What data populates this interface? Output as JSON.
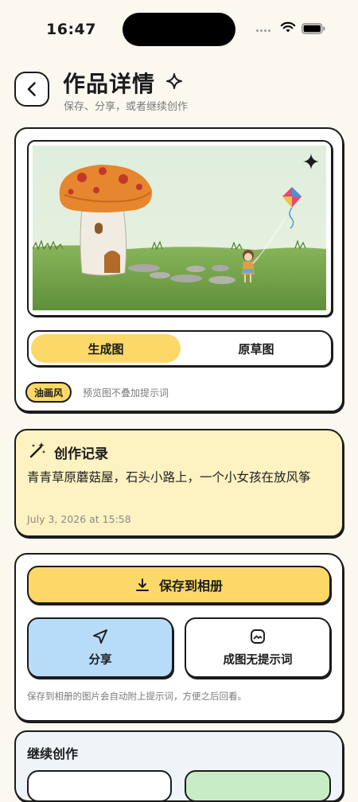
{
  "status_bar": {
    "time": "16:47"
  },
  "header": {
    "title": "作品详情",
    "subtitle": "保存、分享，或者继续创作"
  },
  "artwork": {
    "segments": [
      "生成图",
      "原草图"
    ],
    "active_segment": 0,
    "style_badge": "油画风",
    "preview_note": "预览图不叠加提示词"
  },
  "record": {
    "title": "创作记录",
    "prompt": "青青草原蘑菇屋，石头小路上，一个小女孩在放风筝",
    "date": "July 3, 2026 at 15:58"
  },
  "actions": {
    "save_label": "保存到相册",
    "share_label": "分享",
    "no_prompt_label": "成图无提示词",
    "save_note": "保存到相册的图片会自动附上提示词，方便之后回看。"
  },
  "continue": {
    "title": "继续创作"
  },
  "colors": {
    "accent_yellow": "#fbd867",
    "record_bg": "#fdf2c1",
    "share_blue": "#b7dcfa",
    "continue_green": "#c8ecc3",
    "page_bg": "#fbf8f0"
  },
  "icons": [
    "back-chevron-icon",
    "sparkle-icon",
    "magic-wand-icon",
    "download-icon",
    "send-icon",
    "image-icon",
    "wifi-icon",
    "battery-icon"
  ]
}
